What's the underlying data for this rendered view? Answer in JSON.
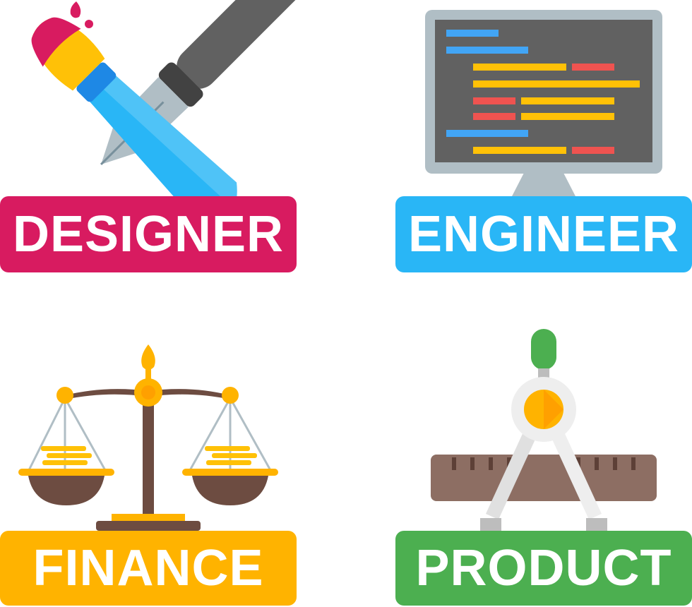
{
  "roles": [
    {
      "label": "DESIGNER",
      "color": "#D81B60",
      "icon": "brush-and-pen-icon"
    },
    {
      "label": "ENGINEER",
      "color": "#29B6F6",
      "icon": "code-monitor-icon"
    },
    {
      "label": "FINANCE",
      "color": "#FFB300",
      "icon": "balance-scale-icon"
    },
    {
      "label": "PRODUCT",
      "color": "#4CAF50",
      "icon": "compass-ruler-icon"
    }
  ]
}
